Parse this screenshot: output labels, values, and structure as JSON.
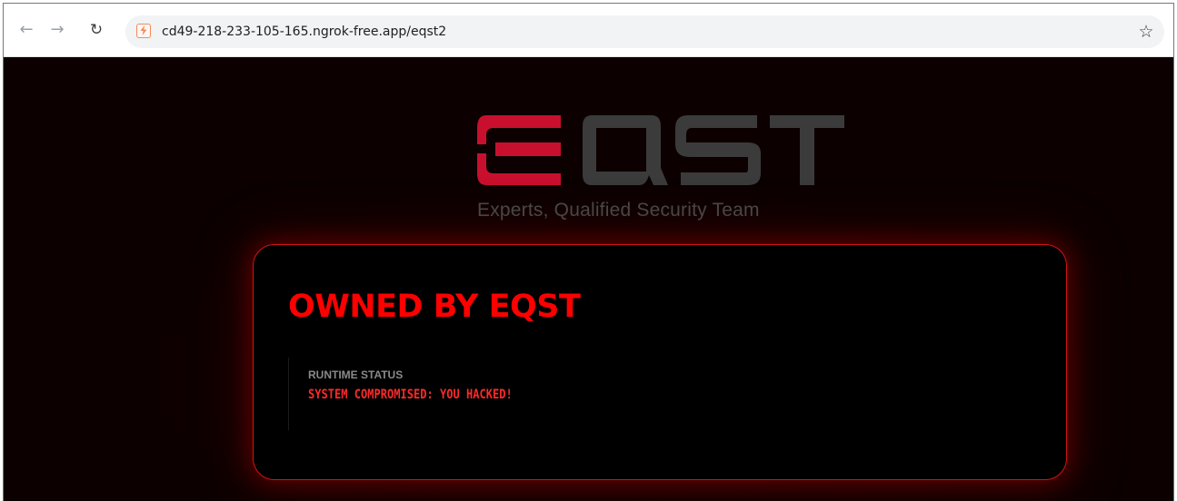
{
  "browser": {
    "back_icon": "←",
    "forward_icon": "→",
    "reload_icon": "↻",
    "site_icon": "ngrok-site-icon",
    "url": "cd49-218-233-105-165.ngrok-free.app/eqst2",
    "bookmark_icon": "☆"
  },
  "page": {
    "logo_text": "EQST",
    "logo_colors": {
      "E": "#c8102e",
      "QST": "#3b3b3b"
    },
    "tagline": "Experts, Qualified Security Team",
    "card": {
      "title": "OWNED BY EQST",
      "status_label": "RUNTIME STATUS",
      "status_value": "SYSTEM COMPROMISED: YOU HACKED!"
    },
    "colors": {
      "background": "#0c0000",
      "accent": "#ff0000",
      "card_border": "#d11414"
    }
  }
}
